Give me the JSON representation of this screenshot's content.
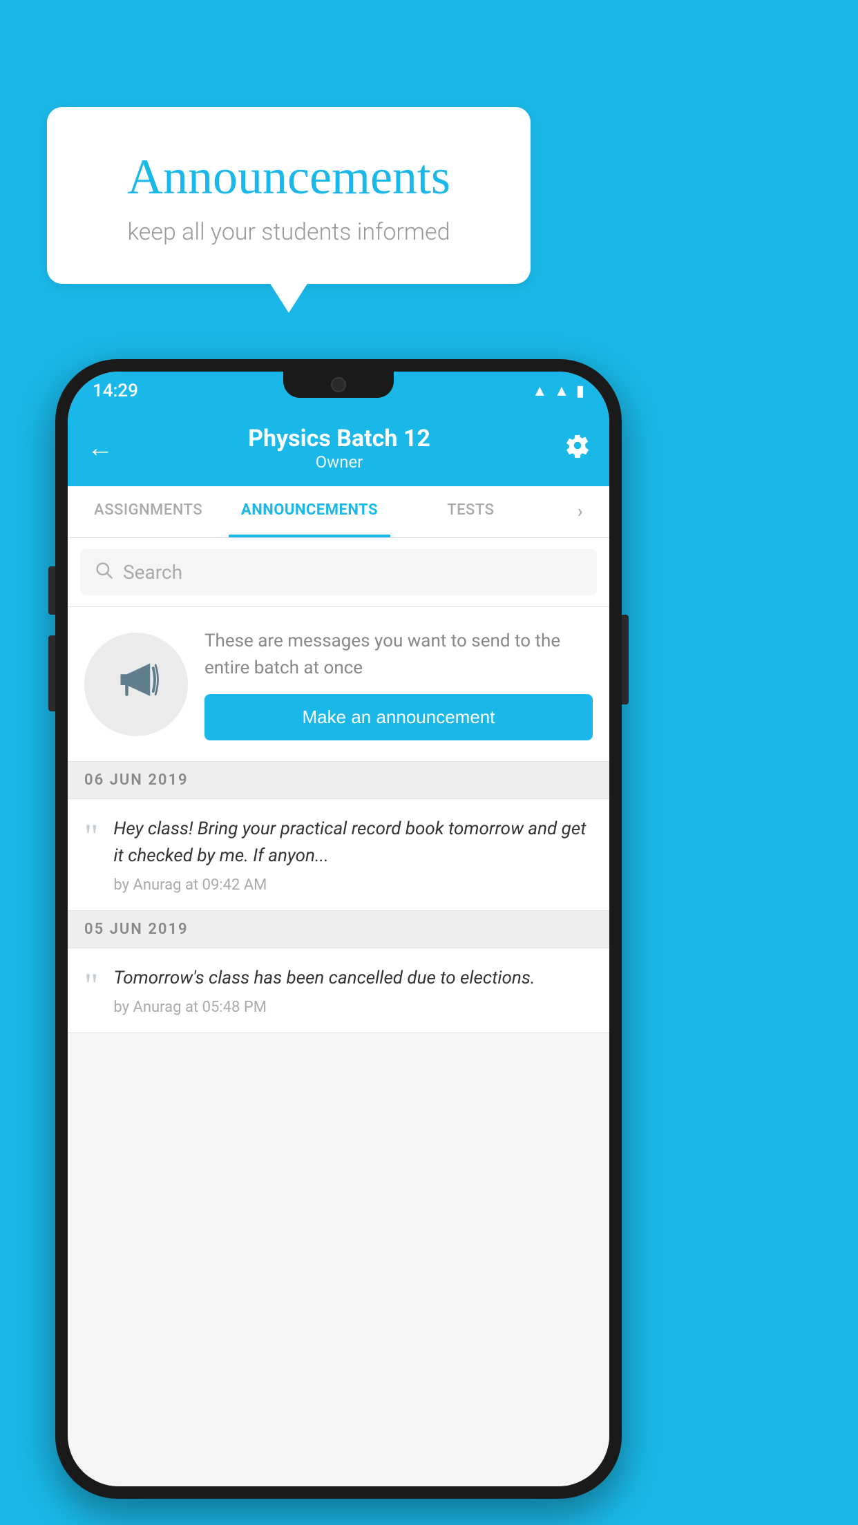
{
  "page": {
    "background_color": "#1ab8e8"
  },
  "speech_bubble": {
    "title": "Announcements",
    "subtitle": "keep all your students informed"
  },
  "status_bar": {
    "time": "14:29",
    "icons": [
      "wifi",
      "signal",
      "battery"
    ]
  },
  "app_bar": {
    "back_label": "←",
    "title": "Physics Batch 12",
    "subtitle": "Owner",
    "settings_label": "⚙"
  },
  "tabs": [
    {
      "label": "ASSIGNMENTS",
      "active": false
    },
    {
      "label": "ANNOUNCEMENTS",
      "active": true
    },
    {
      "label": "TESTS",
      "active": false
    },
    {
      "label": "•••",
      "active": false
    }
  ],
  "search": {
    "placeholder": "Search"
  },
  "announcement_promo": {
    "description_text": "These are messages you want to send to the entire batch at once",
    "button_label": "Make an announcement"
  },
  "date_sections": [
    {
      "date": "06  JUN  2019",
      "items": [
        {
          "text": "Hey class! Bring your practical record book tomorrow and get it checked by me. If anyon...",
          "meta": "by Anurag at 09:42 AM"
        }
      ]
    },
    {
      "date": "05  JUN  2019",
      "items": [
        {
          "text": "Tomorrow's class has been cancelled due to elections.",
          "meta": "by Anurag at 05:48 PM"
        }
      ]
    }
  ]
}
